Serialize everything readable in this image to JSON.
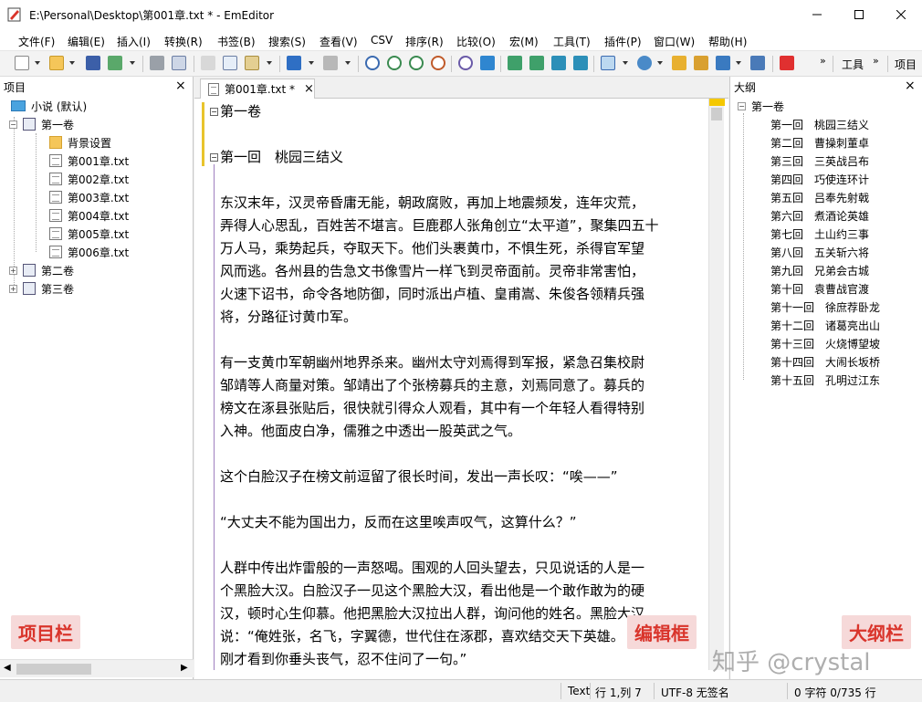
{
  "window": {
    "title": "E:\\Personal\\Desktop\\第001章.txt * - EmEditor"
  },
  "menu": [
    "文件(F)",
    "编辑(E)",
    "插入(I)",
    "转换(R)",
    "书签(B)",
    "搜索(S)",
    "查看(V)",
    "CSV",
    "排序(R)",
    "比较(O)",
    "宏(M)",
    "工具(T)",
    "插件(P)",
    "窗口(W)",
    "帮助(H)"
  ],
  "toolbar": {
    "tools_label": "工具",
    "project_label": "项目"
  },
  "project_panel": {
    "title": "项目",
    "root": "小说 (默认)",
    "volume1": "第一卷",
    "folder": "背景设置",
    "files": [
      "第001章.txt",
      "第002章.txt",
      "第003章.txt",
      "第004章.txt",
      "第005章.txt",
      "第006章.txt"
    ],
    "volume2": "第二卷",
    "volume3": "第三卷",
    "overlay": "项目栏"
  },
  "editor": {
    "tab_label": "第001章.txt *",
    "heading_volume": "第一卷",
    "heading_chapter": "第一回　桃园三结义",
    "paragraphs": [
      [
        "东汉末年，汉灵帝昏庸无能，朝政腐败，再加上地震频发，连年灾荒，",
        "弄得人心思乱，百姓苦不堪言。巨鹿郡人张角创立“太平道”，聚集四五十",
        "万人马，乘势起兵，夺取天下。他们头裹黄巾，不惧生死，杀得官军望",
        "风而逃。各州县的告急文书像雪片一样飞到灵帝面前。灵帝非常害怕，",
        "火速下诏书，命令各地防御，同时派出卢植、皇甫嵩、朱俊各领精兵强",
        "将，分路征讨黄巾军。"
      ],
      [
        "有一支黄巾军朝幽州地界杀来。幽州太守刘焉得到军报，紧急召集校尉",
        "邹靖等人商量对策。邹靖出了个张榜募兵的主意，刘焉同意了。募兵的",
        "榜文在涿县张贴后，很快就引得众人观看，其中有一个年轻人看得特别",
        "入神。他面皮白净，儒雅之中透出一股英武之气。"
      ],
      [
        "这个白脸汉子在榜文前逗留了很长时间，发出一声长叹：“唉——”"
      ],
      [
        "“大丈夫不能为国出力，反而在这里唉声叹气，这算什么？”"
      ],
      [
        "人群中传出炸雷般的一声怒喝。围观的人回头望去，只见说话的人是一",
        "个黑脸大汉。白脸汉子一见这个黑脸大汉，看出他是一个敢作敢为的硬",
        "汉，顿时心生仰慕。他把黑脸大汉拉出人群，询问他的姓名。黑脸大汉",
        "说：“俺姓张，名飞，字翼德，世代住在涿郡，喜欢结交天下英雄。",
        "刚才看到你垂头丧气，忍不住问了一句。”"
      ]
    ],
    "overlay": "编辑框"
  },
  "outline_panel": {
    "title": "大纲",
    "root": "第一卷",
    "items": [
      {
        "num": "第一回",
        "name": "桃园三结义"
      },
      {
        "num": "第二回",
        "name": "曹操刺董卓"
      },
      {
        "num": "第三回",
        "name": "三英战吕布"
      },
      {
        "num": "第四回",
        "name": "巧使连环计"
      },
      {
        "num": "第五回",
        "name": "吕奉先射戟"
      },
      {
        "num": "第六回",
        "name": "煮酒论英雄"
      },
      {
        "num": "第七回",
        "name": "土山约三事"
      },
      {
        "num": "第八回",
        "name": "五关斩六将"
      },
      {
        "num": "第九回",
        "name": "兄弟会古城"
      },
      {
        "num": "第十回",
        "name": "袁曹战官渡"
      },
      {
        "num": "第十一回",
        "name": "徐庶荐卧龙"
      },
      {
        "num": "第十二回",
        "name": "诸葛亮出山"
      },
      {
        "num": "第十三回",
        "name": "火烧博望坡"
      },
      {
        "num": "第十四回",
        "name": "大闹长坂桥"
      },
      {
        "num": "第十五回",
        "name": "孔明过江东"
      }
    ],
    "overlay": "大纲栏"
  },
  "status": {
    "mode": "Text",
    "position": "行 1,列 7",
    "encoding": "UTF-8 无签名",
    "counts": "0 字符  0/735 行"
  },
  "watermark": "知乎 @crystal",
  "colors": {
    "overlay_text": "#d9342b",
    "overlay_bg": "#f6d9d9",
    "fold_bar": "#e8c42c"
  }
}
